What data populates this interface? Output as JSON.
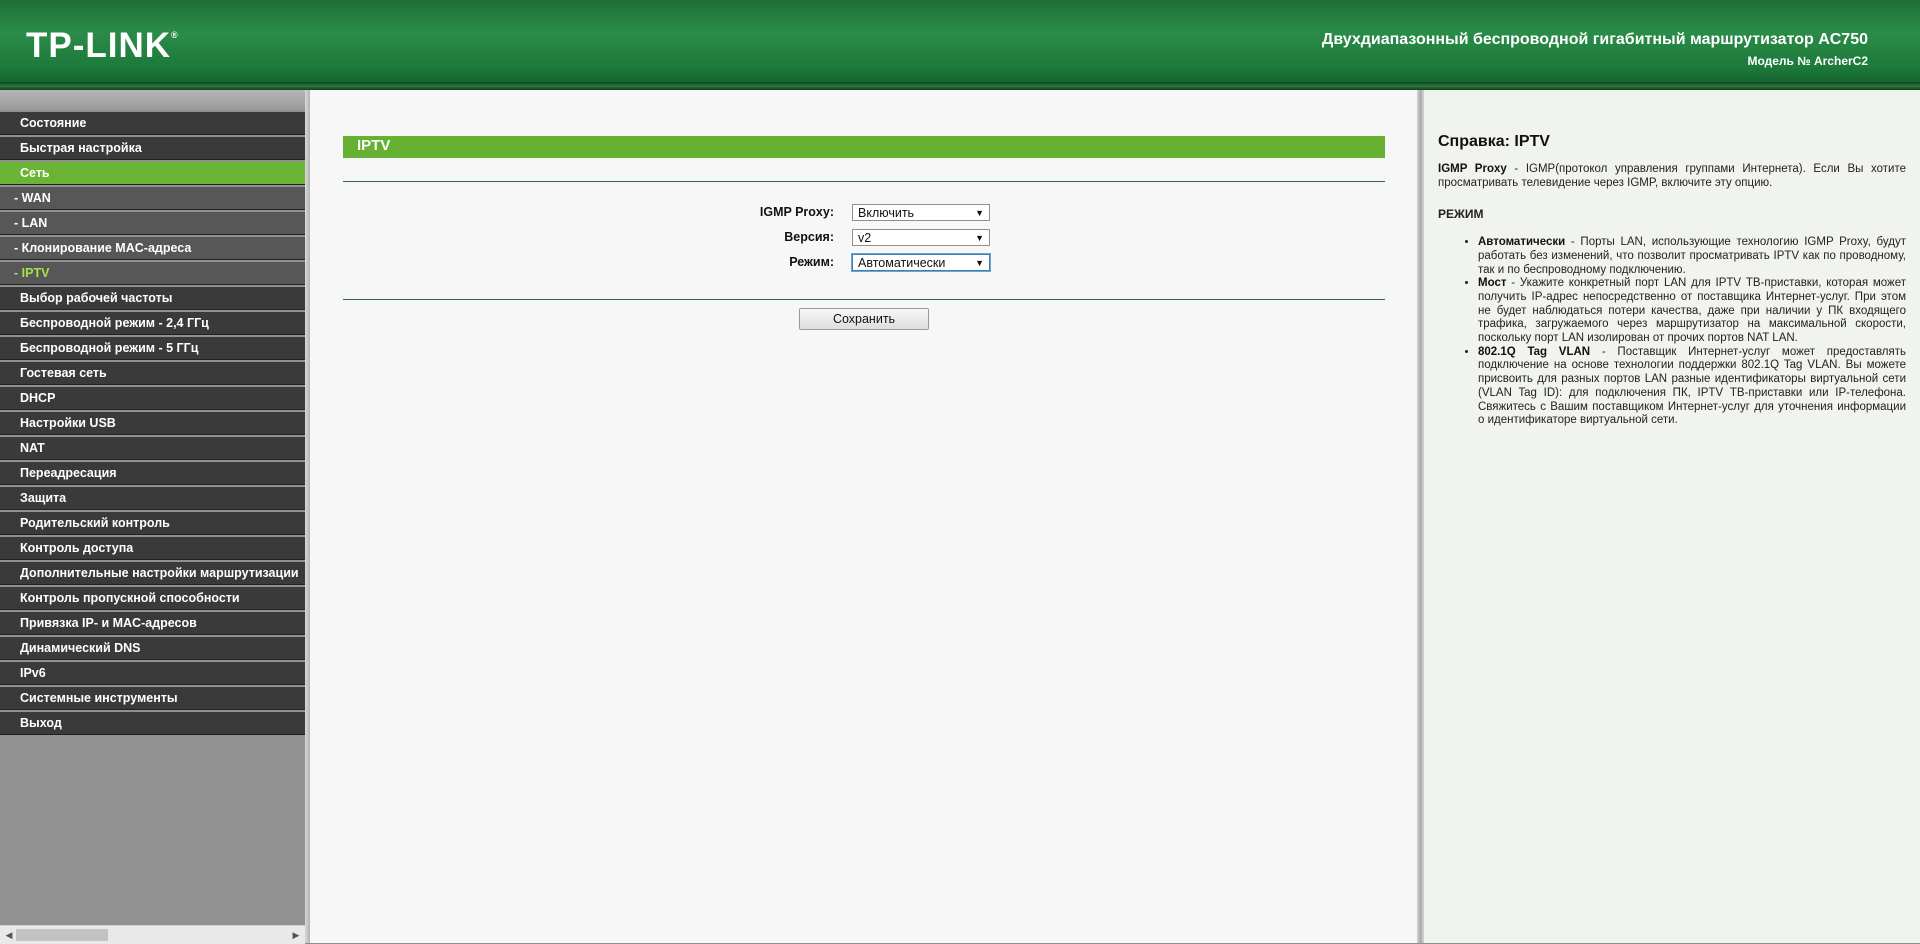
{
  "header": {
    "logo": "TP-LINK",
    "logo_mark": "®",
    "title": "Двухдиапазонный беспроводной гигабитный маршрутизатор AC750",
    "model": "Модель № ArcherC2"
  },
  "sidebar": {
    "items": [
      {
        "label": "Состояние"
      },
      {
        "label": "Быстрая настройка"
      },
      {
        "label": "Сеть"
      },
      {
        "label": "- WAN"
      },
      {
        "label": "- LAN"
      },
      {
        "label": "- Клонирование MAC-адреса"
      },
      {
        "label": "- IPTV"
      },
      {
        "label": "Выбор рабочей частоты"
      },
      {
        "label": "Беспроводной режим - 2,4 ГГц"
      },
      {
        "label": "Беспроводной режим - 5 ГГц"
      },
      {
        "label": "Гостевая сеть"
      },
      {
        "label": "DHCP"
      },
      {
        "label": "Настройки USB"
      },
      {
        "label": "NAT"
      },
      {
        "label": "Переадресация"
      },
      {
        "label": "Защита"
      },
      {
        "label": "Родительский контроль"
      },
      {
        "label": "Контроль доступа"
      },
      {
        "label": "Дополнительные настройки маршрутизации"
      },
      {
        "label": "Контроль пропускной способности"
      },
      {
        "label": "Привязка IP- и MAC-адресов"
      },
      {
        "label": "Динамический DNS"
      },
      {
        "label": "IPv6"
      },
      {
        "label": "Системные инструменты"
      },
      {
        "label": "Выход"
      }
    ]
  },
  "main": {
    "title": "IPTV",
    "form": {
      "igmp_proxy_label": "IGMP Proxy:",
      "igmp_proxy_value": "Включить",
      "version_label": "Версия:",
      "version_value": "v2",
      "mode_label": "Режим:",
      "mode_value": "Автоматически"
    },
    "save_label": "Сохранить"
  },
  "help": {
    "title": "Справка: IPTV",
    "igmp_term": "IGMP Proxy",
    "igmp_text": " - IGMP(протокол управления группами Интернета). Если Вы хотите просматривать телевидение через IGMP, включите эту опцию.",
    "mode_heading": "РЕЖИМ",
    "items": [
      {
        "term": "Автоматически",
        "text": " - Порты LAN, использующие технологию IGMP Proxy, будут работать без изменений, что позволит просматривать IPTV как по проводному, так и по беспроводному подключению."
      },
      {
        "term": "Мост",
        "text": " - Укажите конкретный порт LAN для IPTV ТВ-приставки, которая может получить IP-адрес непосредственно от поставщика Интернет-услуг. При этом не будет наблюдаться потери качества, даже при наличии у ПК входящего трафика, загружаемого через маршрутизатор на максимальной скорости, поскольку порт LAN изолирован от прочих портов NAT LAN."
      },
      {
        "term": "802.1Q Tag VLAN",
        "text": " - Поставщик Интернет-услуг может предоставлять подключение на основе технологии поддержки 802.1Q Tag VLAN. Вы можете присвоить для разных портов LAN разные идентификаторы виртуальной сети (VLAN Tag ID): для подключения ПК, IPTV ТВ-приставки или IP-телефона. Свяжитесь с Вашим поставщиком Интернет-услуг для уточнения информации о идентификаторе виртуальной сети."
      }
    ]
  },
  "colors": {
    "header_green": "#2b8c48",
    "active_menu": "#6ab536",
    "current_submenu_text": "#a6e24a",
    "title_bar": "#66b132"
  },
  "icons": {
    "dropdown_arrow": "chevron-down-icon",
    "scroll_left": "arrow-left-icon",
    "scroll_right": "arrow-right-icon"
  }
}
